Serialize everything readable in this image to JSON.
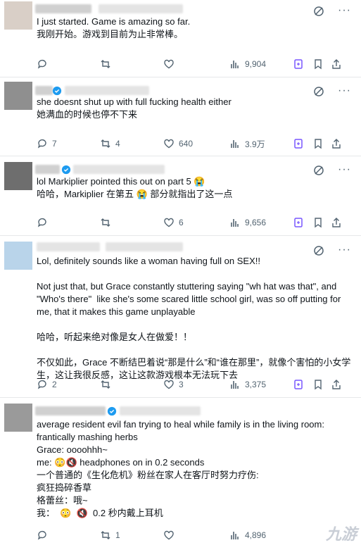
{
  "posts": [
    {
      "text": "I just started. Game is amazing so far.\n我刚开始。游戏到目前为止非常棒。",
      "replies": "",
      "reposts": "",
      "likes": "",
      "views": "9,904"
    },
    {
      "text": "she doesnt shut up with full fucking health either\n她满血的时候也停不下来",
      "replies": "7",
      "reposts": "4",
      "likes": "640",
      "views": "3.9万"
    },
    {
      "text": "lol Markiplier pointed this out on part 5 😭\n哈哈，Markiplier 在第五 😭 部分就指出了这一点",
      "replies": "",
      "reposts": "",
      "likes": "6",
      "views": "9,656"
    },
    {
      "text": "Lol, definitely sounds like a woman having full on SEX!!\n\nNot just that, but Grace constantly stuttering saying \"wh hat was that\", and \"Who's there\"  like she's some scared little school girl, was so off putting for me, that it makes this game unplayable\n\n哈哈，听起来绝对像是女人在做爱！！\n\n不仅如此，Grace 不断结巴着说“那是什么”和“谁在那里”，就像个害怕的小女学生，这让我很反感，这让这款游戏根本无法玩下去",
      "replies": "2",
      "reposts": "",
      "likes": "3",
      "views": "3,375"
    },
    {
      "text": "average resident evil fan trying to heal while family is in the living room:\nfrantically mashing herbs\nGrace: oooohhh~\nme: 😳🔇 headphones on in 0.2 seconds\n一个普通的《生化危机》粉丝在家人在客厅时努力疗伤:\n疯狂捣碎香草\n格蕾丝：哦~\n我：  😳  🔇  0.2 秒内戴上耳机",
      "replies": "",
      "reposts": "1",
      "likes": "",
      "views": "4,896"
    }
  ],
  "icons": {
    "reply": "reply-icon",
    "repost": "repost-icon",
    "like": "like-icon",
    "views": "views-icon",
    "grok": "grok-icon",
    "bookmark": "bookmark-icon",
    "share": "share-icon",
    "more": "more-icon"
  },
  "colors": {
    "accent": "#1d9bf0",
    "grok": "#7856ff",
    "muted": "#536471"
  },
  "watermark": "九游"
}
